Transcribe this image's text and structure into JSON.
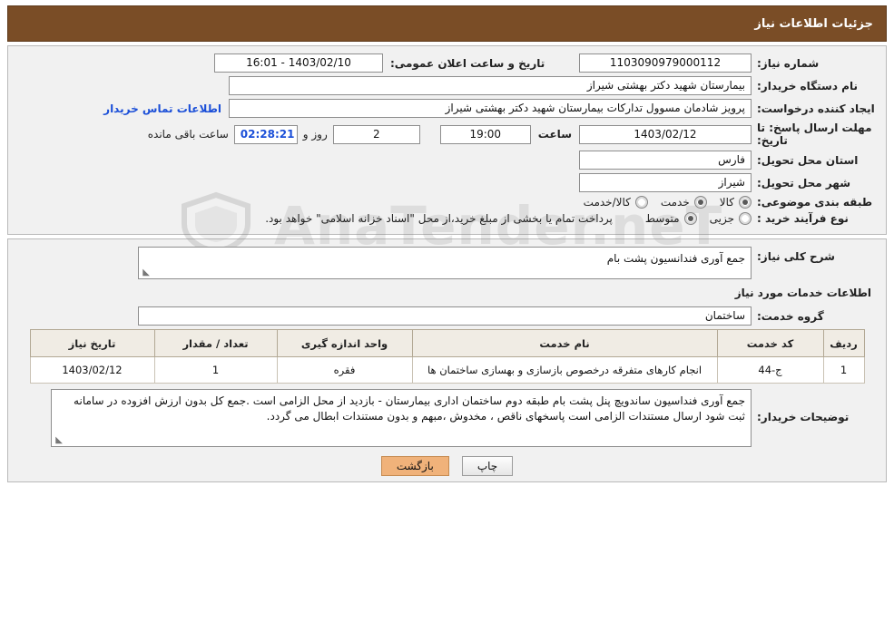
{
  "header": {
    "title": "جزئیات اطلاعات نیاز"
  },
  "form": {
    "need_number_label": "شماره نیاز:",
    "need_number_value": "1103090979000112",
    "announce_datetime_label": "تاریخ و ساعت اعلان عمومی:",
    "announce_datetime_value": "1403/02/10 - 16:01",
    "buyer_org_label": "نام دستگاه خریدار:",
    "buyer_org_value": "بیمارستان شهید دکتر بهشتی شیراز",
    "requester_label": "ایجاد کننده درخواست:",
    "requester_value": "پرویز شادمان مسوول تدارکات بیمارستان شهید دکتر بهشتی شیراز",
    "buyer_contact_link": "اطلاعات تماس خریدار",
    "deadline_label": "مهلت ارسال پاسخ: تا تاریخ:",
    "deadline_date": "1403/02/12",
    "deadline_hour_label": "ساعت",
    "deadline_hour": "19:00",
    "remaining_days": "2",
    "remaining_days_label": "روز و",
    "remaining_time": "02:28:21",
    "remaining_suffix": "ساعت باقی مانده",
    "province_label": "استان محل تحویل:",
    "province_value": "فارس",
    "city_label": "شهر محل تحویل:",
    "city_value": "شیراز",
    "category_label": "طبقه بندی موضوعی:",
    "category_options": [
      {
        "label": "کالا",
        "checked": true
      },
      {
        "label": "خدمت",
        "checked": true
      },
      {
        "label": "کالا/خدمت",
        "checked": false
      }
    ],
    "process_label": "نوع فرآیند خرید :",
    "process_options": [
      {
        "label": "جزیی",
        "checked": false
      },
      {
        "label": "متوسط",
        "checked": true
      }
    ],
    "process_note": "پرداخت تمام یا بخشی از مبلغ خرید،از محل \"اسناد خزانه اسلامی\" خواهد بود."
  },
  "description": {
    "general_label": "شرح کلی نیاز:",
    "general_value": "جمع آوری فندانسیون پشت بام",
    "services_info_title": "اطلاعات خدمات مورد نیاز",
    "service_group_label": "گروه خدمت:",
    "service_group_value": "ساختمان"
  },
  "table": {
    "headers": [
      "ردیف",
      "کد خدمت",
      "نام خدمت",
      "واحد اندازه گیری",
      "تعداد / مقدار",
      "تاریخ نیاز"
    ],
    "rows": [
      {
        "index": "1",
        "code": "ج-44",
        "name": "انجام کارهای متفرقه درخصوص بازسازی و بهسازی ساختمان ها",
        "unit": "فقره",
        "qty": "1",
        "date": "1403/02/12"
      }
    ]
  },
  "buyer_notes": {
    "label": "توضیحات خریدار:",
    "value": "جمع آوری فنداسیون ساندویچ پنل پشت بام طبقه دوم ساختمان اداری بیمارستان - بازدید از محل الزامی است .جمع کل بدون ارزش افزوده در سامانه ثبت شود ارسال مستندات الزامی است پاسخهای ناقص ، مخدوش ،مبهم و بدون مستندات ابطال می گردد."
  },
  "footer": {
    "print_label": "چاپ",
    "back_label": "بازگشت"
  },
  "watermark": {
    "text": "AnaTender.neT"
  },
  "colors": {
    "header_bg": "#7a4d26",
    "accent_link": "#1b4fd8",
    "back_button": "#f0b27a",
    "panel_bg": "#f1f1f1"
  }
}
